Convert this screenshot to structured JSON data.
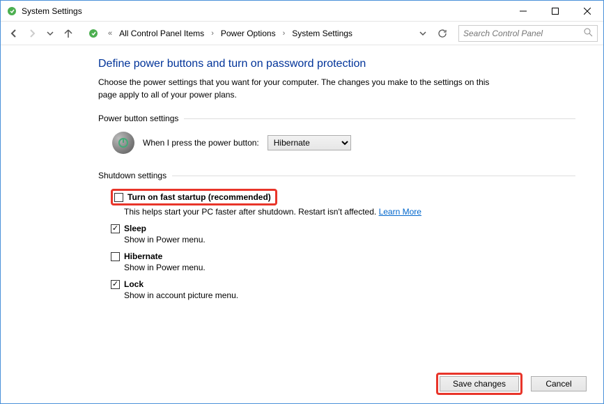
{
  "window": {
    "title": "System Settings"
  },
  "breadcrumb": {
    "prefix": "«",
    "items": [
      "All Control Panel Items",
      "Power Options",
      "System Settings"
    ]
  },
  "search": {
    "placeholder": "Search Control Panel"
  },
  "page": {
    "heading": "Define power buttons and turn on password protection",
    "desc": "Choose the power settings that you want for your computer. The changes you make to the settings on this page apply to all of your power plans."
  },
  "power_button": {
    "section_title": "Power button settings",
    "label": "When I press the power button:",
    "selected": "Hibernate"
  },
  "shutdown": {
    "section_title": "Shutdown settings",
    "items": [
      {
        "label": "Turn on fast startup (recommended)",
        "checked": false,
        "sub_prefix": "This helps start your PC faster after shutdown. Restart isn't affected. ",
        "sub_link": "Learn More",
        "highlighted": true
      },
      {
        "label": "Sleep",
        "checked": true,
        "sub": "Show in Power menu."
      },
      {
        "label": "Hibernate",
        "checked": false,
        "sub": "Show in Power menu."
      },
      {
        "label": "Lock",
        "checked": true,
        "sub": "Show in account picture menu."
      }
    ]
  },
  "buttons": {
    "save": "Save changes",
    "cancel": "Cancel"
  }
}
